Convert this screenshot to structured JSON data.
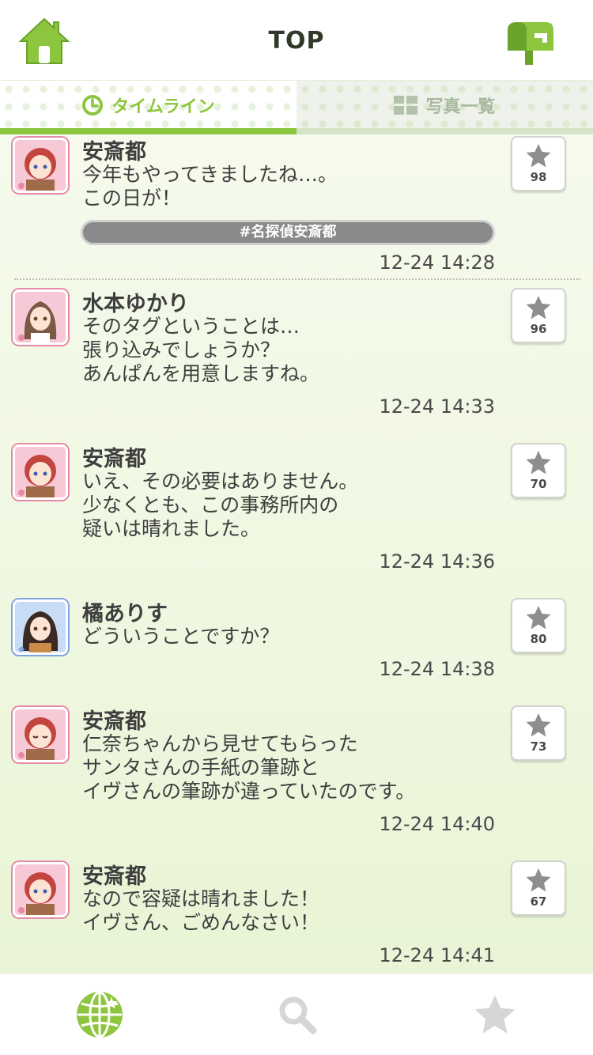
{
  "header": {
    "title": "TOP",
    "home_icon": "home-icon",
    "mail_icon": "mailbox-icon"
  },
  "tabs": [
    {
      "label": "タイムライン",
      "icon": "clock-icon",
      "active": true
    },
    {
      "label": "写真一覧",
      "icon": "grid-icon",
      "active": false
    }
  ],
  "colors": {
    "accent": "#8cc63e",
    "text": "#3e3e3e",
    "idol_cute": "#e58aa8",
    "idol_cool": "#7fa4e6"
  },
  "posts": [
    {
      "name": "安斎都",
      "text": "今年もやってきましたね…。\nこの日が！",
      "hashtag": "#名探偵安斎都",
      "time": "12-24 14:28",
      "stars": "98",
      "avatar_type": "cute"
    },
    {
      "name": "水本ゆかり",
      "text": "そのタグということは…\n張り込みでしょうか？\nあんぱんを用意しますね。",
      "time": "12-24 14:33",
      "stars": "96",
      "avatar_type": "cute"
    },
    {
      "name": "安斎都",
      "text": "いえ、その必要はありません。\n少なくとも、この事務所内の\n疑いは晴れました。",
      "time": "12-24 14:36",
      "stars": "70",
      "avatar_type": "cute"
    },
    {
      "name": "橘ありす",
      "text": "どういうことですか？",
      "time": "12-24 14:38",
      "stars": "80",
      "avatar_type": "cool"
    },
    {
      "name": "安斎都",
      "text": "仁奈ちゃんから見せてもらった\nサンタさんの手紙の筆跡と\nイヴさんの筆跡が違っていたのです。",
      "time": "12-24 14:40",
      "stars": "73",
      "avatar_type": "cute"
    },
    {
      "name": "安斎都",
      "text": "なので容疑は晴れました！\nイヴさん、ごめんなさい！",
      "time": "12-24 14:41",
      "stars": "67",
      "avatar_type": "cute"
    }
  ],
  "bottom_nav": [
    {
      "icon": "globe-icon",
      "active": true
    },
    {
      "icon": "search-icon",
      "active": false
    },
    {
      "icon": "star-icon",
      "active": false
    }
  ]
}
